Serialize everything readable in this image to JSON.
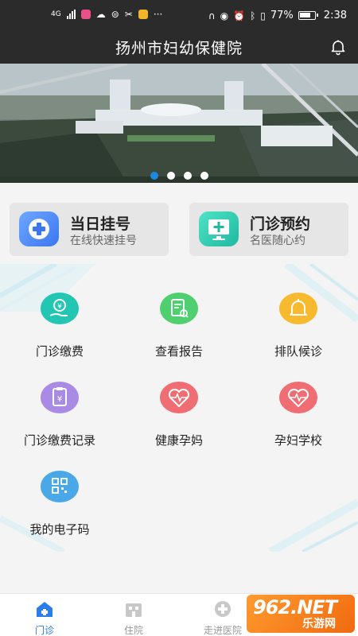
{
  "status_bar": {
    "network": "4G",
    "battery": "77%",
    "time": "2:38"
  },
  "header": {
    "title": "扬州市妇幼保健院",
    "bell_icon": "bell-icon"
  },
  "banner": {
    "dots": 4,
    "active_dot": 0
  },
  "quick": [
    {
      "title": "当日挂号",
      "subtitle": "在线快速挂号",
      "icon": "plus-cross-icon"
    },
    {
      "title": "门诊预约",
      "subtitle": "名医随心约",
      "icon": "monitor-plus-icon"
    }
  ],
  "services": [
    {
      "label": "门诊缴费",
      "icon": "payment-hand-icon",
      "color": "#22c6b3"
    },
    {
      "label": "查看报告",
      "icon": "report-search-icon",
      "color": "#4fcf6f"
    },
    {
      "label": "排队候诊",
      "icon": "bell-queue-icon",
      "color": "#f7b92e"
    },
    {
      "label": "门诊缴费记录",
      "icon": "payment-record-icon",
      "color": "#a98be6"
    },
    {
      "label": "健康孕妈",
      "icon": "heart-pulse-icon",
      "color": "#f06e73"
    },
    {
      "label": "孕妇学校",
      "icon": "heart-pulse-icon",
      "color": "#f06e73"
    },
    {
      "label": "我的电子码",
      "icon": "qr-code-icon",
      "color": "#4aa8e8"
    }
  ],
  "bottom_nav": [
    {
      "label": "门诊",
      "icon": "home-icon",
      "active": true
    },
    {
      "label": "住院",
      "icon": "hospital-icon",
      "active": false
    },
    {
      "label": "走进医院",
      "icon": "hospital-cross-icon",
      "active": false
    }
  ],
  "watermark": {
    "big": "962.NET",
    "small": "乐游网"
  }
}
